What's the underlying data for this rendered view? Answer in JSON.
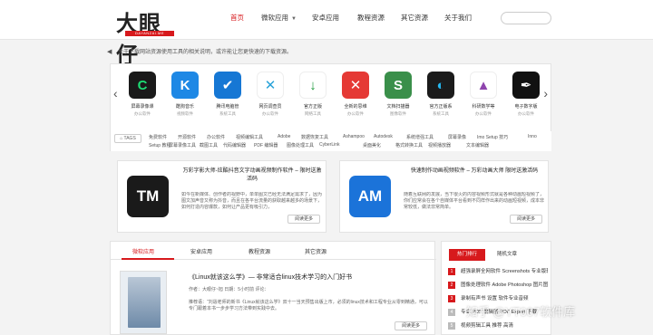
{
  "logo": {
    "text": "大眼仔",
    "sub": "DAYANZAI.ME"
  },
  "nav": [
    {
      "label": "首页",
      "active": true,
      "caret": false
    },
    {
      "label": "微软应用",
      "active": false,
      "caret": true
    },
    {
      "label": "安卓应用",
      "active": false,
      "caret": false
    },
    {
      "label": "教程资源",
      "active": false,
      "caret": false
    },
    {
      "label": "其它资源",
      "active": false,
      "caret": false
    },
    {
      "label": "关于我们",
      "active": false,
      "caret": false
    }
  ],
  "search": {
    "placeholder": ""
  },
  "notice": "关于下载网站资源使用工具的相关说明，或许能让您更快速的下载资源。",
  "apps": [
    {
      "name": "屏幕录像课",
      "cat": "办公软件",
      "color": "#1a1a1a",
      "glyph": "C",
      "fg": "#1ddc74"
    },
    {
      "name": "酷狗音乐",
      "cat": "视频软件",
      "color": "#1e88e5",
      "glyph": "K",
      "fg": "#ffffff"
    },
    {
      "name": "腾讯电脑管",
      "cat": "系统工具",
      "color": "#1677d4",
      "glyph": "✔",
      "fg": "#ffffff"
    },
    {
      "name": "网页调查员",
      "cat": "办公软件",
      "color": "#ffffff",
      "glyph": "✕",
      "fg": "#2aa3d9"
    },
    {
      "name": "官方正版",
      "cat": "网络工具",
      "color": "#ffffff",
      "glyph": "↓",
      "fg": "#1e9b3c"
    },
    {
      "name": "全新的思维",
      "cat": "办公软件",
      "color": "#e53935",
      "glyph": "✕",
      "fg": "#ffffff"
    },
    {
      "name": "文档扫描器",
      "cat": "图像软件",
      "color": "#3a8f4a",
      "glyph": "S",
      "fg": "#ffffff"
    },
    {
      "name": "官方正版系",
      "cat": "系统工具",
      "color": "#1b1b1b",
      "glyph": "◐",
      "fg": "#25b8f0"
    },
    {
      "name": "科研数学等",
      "cat": "办公软件",
      "color": "#ffffff",
      "glyph": "▲",
      "fg": "#8e44ad"
    },
    {
      "name": "电子数字版",
      "cat": "办公软件",
      "color": "#111111",
      "glyph": "✒",
      "fg": "#ffffff"
    }
  ],
  "tags_label": "TAGS",
  "tags": [
    "免费软件",
    "开源软件",
    "办公软件",
    "视频编辑工具",
    "Adobe",
    "数据恢复工具",
    "Ashampoo",
    "Autodesk",
    "系统增强工具",
    "屏幕录像",
    "Imo Setup 技巧",
    "Inno",
    "Setup 教程",
    "屏幕录像工具",
    "截图工具",
    "代码编辑器",
    "PDF 编辑器",
    "图像处理工具",
    "CyberLink",
    "桌面美化",
    "格式转换工具",
    "视频播放器",
    "文本编辑器"
  ],
  "features": [
    {
      "icon_text": "TM",
      "icon_color": "#1a1a1a",
      "title": "万彩字影大师-炫酷抖音文字动画视频制作软件 – 限时送激活码",
      "desc": "如今在新媒体、创作者的视野中，单单图文已经无法满足需求了，因为图文加声音又称为抖音，而且在各平台流量的获取越来越多的场景下，如何打造内容爆款，如何让产品更有吸引力，",
      "more": "阅读更多"
    },
    {
      "icon_text": "AM",
      "icon_color": "#1b73d9",
      "title": "快速制作动画视频软件 – 万彩动画大师 限时送激活码",
      "desc": "随着互联网的发展，当下很火的内容视频形式就是各种动画短视频了，你们应常会在各个自媒体平台看到不同样作出来的动画短视频，成本非常较低，做法非常简单。",
      "more": "阅读更多"
    }
  ],
  "article_tabs": [
    {
      "label": "微软应用",
      "active": true
    },
    {
      "label": "安卓应用",
      "active": false
    },
    {
      "label": "教程资源",
      "active": false
    },
    {
      "label": "其它资源",
      "active": false
    }
  ],
  "article": {
    "title": "《Linux就该这么学》— 非常适合linux技术学习的入门好书",
    "meta": "作者：大眼仔~旭 日期：5小时前 评论：",
    "desc": "推荐语：“刘遄老师的新书《Linux就该这么学》双十一当天预售出版上市，必须的linux技术和工程专业从零到精通，可以专门跟着本书一步步学习方法带到实践中去。",
    "more": "阅读更多"
  },
  "side_tabs": {
    "active": "热门排行",
    "second": "随机文章"
  },
  "ranking": [
    {
      "num": "1",
      "text": "超强录屏全网软件 Screenshots 专业版软件"
    },
    {
      "num": "2",
      "text": "图像处理软件 Adobe Photoshop 图片图像"
    },
    {
      "num": "3",
      "text": "录制有声书 设置 软件专业音频"
    },
    {
      "num": "4",
      "text": "专业 PDF 编辑器 PDF Expert 下载"
    },
    {
      "num": "5",
      "text": "视频剪辑工具 推荐 高清"
    }
  ],
  "watermark": "知乎 @YT007软件库"
}
